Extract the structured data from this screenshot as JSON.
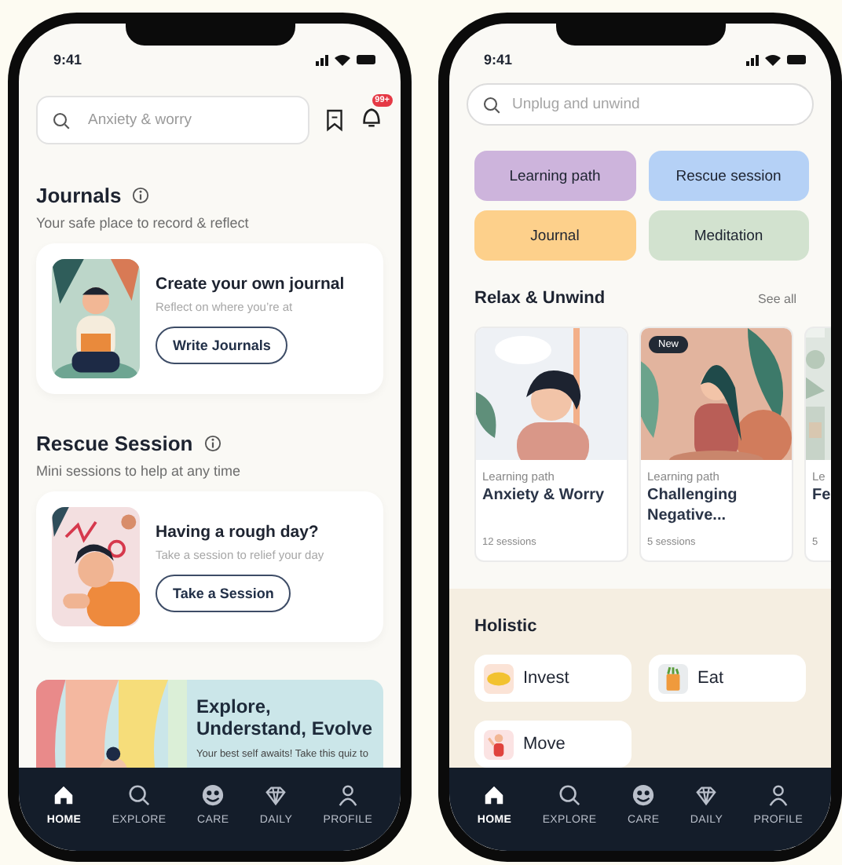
{
  "phones": [
    {
      "kind": "home",
      "status_time": "9:41",
      "search": {
        "placeholder": "Anxiety & worry"
      },
      "notification_badge": "99+",
      "sections": [
        {
          "title": "Journals",
          "subtitle": "Your safe place to record & reflect",
          "card": {
            "title": "Create your own journal",
            "text": "Reflect on where you’re at",
            "button": "Write Journals"
          }
        },
        {
          "title": "Rescue Session",
          "subtitle": "Mini sessions to help at any time",
          "card": {
            "title": "Having a rough day?",
            "text": "Take a session to relief your day",
            "button": "Take a Session"
          }
        }
      ],
      "banner": {
        "title": "Explore, Understand, Evolve",
        "text": "Your best self awaits! Take this quiz to"
      },
      "nav": [
        {
          "label": "HOME",
          "selected": true
        },
        {
          "label": "EXPLORE",
          "selected": false
        },
        {
          "label": "CARE",
          "selected": false
        },
        {
          "label": "DAILY",
          "selected": false
        },
        {
          "label": "PROFILE",
          "selected": false
        }
      ]
    },
    {
      "kind": "explore",
      "status_time": "9:41",
      "search": {
        "placeholder": "Unplug and unwind"
      },
      "chips": [
        {
          "label": "Learning path",
          "color": "#cdb4dc"
        },
        {
          "label": "Rescue session",
          "color": "#b5d1f6"
        },
        {
          "label": "Journal",
          "color": "#fdd08b"
        },
        {
          "label": "Meditation",
          "color": "#d2e2cf"
        }
      ],
      "relax": {
        "title": "Relax & Unwind",
        "see_all": "See all",
        "cards": [
          {
            "label": "Learning path",
            "title": "Anxiety & Worry",
            "sessions": "12 sessions"
          },
          {
            "label": "Learning path",
            "title": "Challenging Negative...",
            "sessions": "5 sessions",
            "badge": "New"
          },
          {
            "label": "Le",
            "title": "Fe",
            "sessions": "5"
          }
        ]
      },
      "holistic": {
        "title": "Holistic",
        "items": [
          {
            "label": "Invest"
          },
          {
            "label": "Eat"
          },
          {
            "label": "Move"
          }
        ]
      },
      "nav": [
        {
          "label": "HOME",
          "selected": true
        },
        {
          "label": "EXPLORE",
          "selected": false
        },
        {
          "label": "CARE",
          "selected": false
        },
        {
          "label": "DAILY",
          "selected": false
        },
        {
          "label": "PROFILE",
          "selected": false
        }
      ]
    }
  ]
}
